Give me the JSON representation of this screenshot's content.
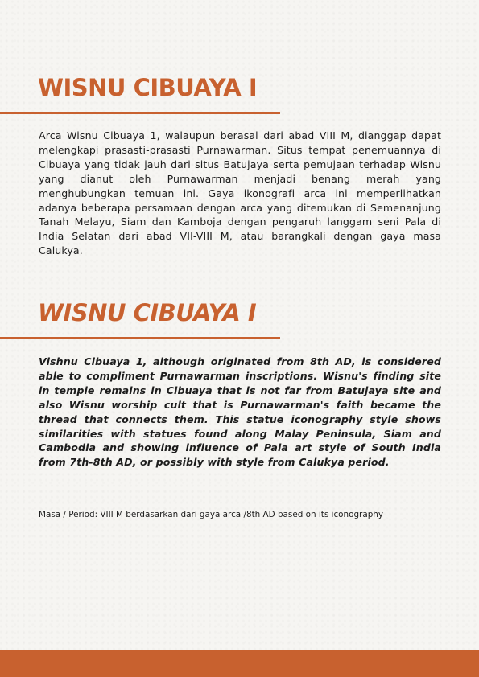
{
  "section_id": {
    "title": "WISNU CIBUAYA I",
    "body": "Arca Wisnu Cibuaya 1, walaupun berasal dari abad VIII M, dianggap dapat melengkapi prasasti-prasasti Purnawarman. Situs tempat penemuannya di Cibuaya yang tidak jauh dari situs Batujaya serta pemujaan terhadap Wisnu yang dianut oleh Purnawarman menjadi benang merah yang menghubungkan temuan ini. Gaya ikonografi arca ini memperlihatkan adanya beberapa persamaan dengan arca yang ditemukan di Semenanjung Tanah Melayu, Siam dan Kamboja dengan pengaruh langgam seni Pala di India Selatan dari abad VII-VIII M, atau barangkali dengan gaya masa Calukya."
  },
  "section_en": {
    "title": "WISNU CIBUAYA I",
    "body": "Vishnu Cibuaya 1, although originated from 8th AD, is considered able to compliment Purnawarman inscriptions. Wisnu's finding site in temple remains in Cibuaya that is not far from Batujaya site and also Wisnu worship cult that is Purnawarman's faith became the thread that connects them. This statue iconography style shows similarities with statues found along Malay Peninsula, Siam and Cambodia and showing influence of Pala art style of South India from 7th-8th AD, or possibly with style from Calukya period."
  },
  "period": "Masa / Period: VIII M berdasarkan dari gaya arca /8th AD based on its iconography",
  "colors": {
    "accent": "#c8612f",
    "text": "#1c1c1c",
    "background": "#f6f5f2"
  }
}
